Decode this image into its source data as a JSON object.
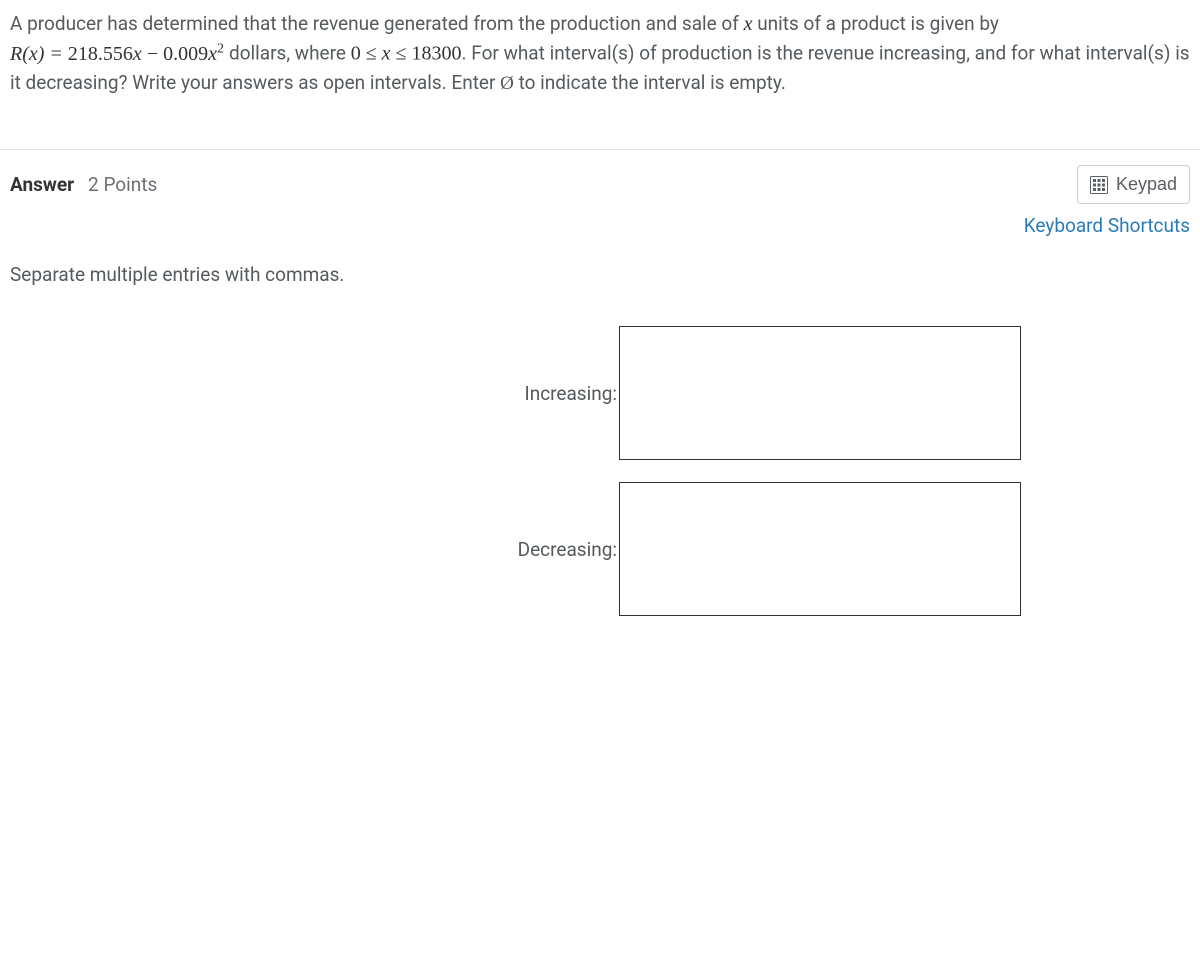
{
  "question": {
    "sentence1_pre": "A producer has determined that the revenue generated from the production and sale of ",
    "x_var": "x",
    "sentence1_post": " units of a product is given by",
    "formula_lhs": "R(x) = ",
    "formula_num1": "218.556",
    "formula_x1": "x",
    "formula_minus": " − ",
    "formula_num2": "0.009",
    "formula_x2": "x",
    "formula_exp": "2",
    "formula_tail": " dollars, where ",
    "domain_expr_pre": "0 ≤ ",
    "domain_expr_x": "x",
    "domain_expr_post": " ≤ 18300",
    "sentence2": ". For what interval(s) of production is the revenue increasing, and for what interval(s) is it decreasing? Write your answers as open intervals. Enter ",
    "emptyset": "Ø",
    "sentence3": " to indicate the interval is empty."
  },
  "answer_header": {
    "label": "Answer",
    "points": "2 Points"
  },
  "controls": {
    "keypad": "Keypad",
    "shortcuts": "Keyboard Shortcuts"
  },
  "instruction": "Separate multiple entries with commas.",
  "inputs": {
    "increasing_label": "Increasing:",
    "decreasing_label": "Decreasing:",
    "increasing_value": "",
    "decreasing_value": ""
  }
}
